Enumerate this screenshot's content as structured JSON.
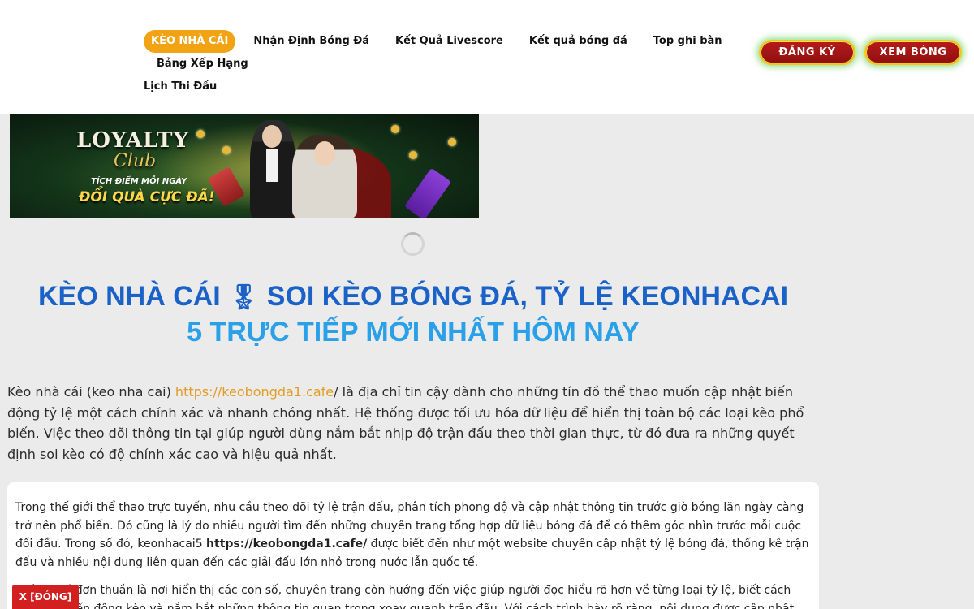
{
  "nav": {
    "items": [
      {
        "label": "KÈO NHÀ CÁI",
        "active": true
      },
      {
        "label": "Nhận Định Bóng Đá"
      },
      {
        "label": "Kết Quả Livescore"
      },
      {
        "label": "Kết quả bóng đá"
      },
      {
        "label": "Top ghi bàn"
      },
      {
        "label": "Bảng Xếp Hạng"
      },
      {
        "label": "Lịch Thi Đấu"
      }
    ],
    "active_color": "#f2a313"
  },
  "cta": {
    "register_label": "ĐĂNG KÝ",
    "watch_label": "XEM BÓNG",
    "color": "#b71c1c"
  },
  "banner": {
    "logo_line1": "LOYALTY",
    "logo_line2": "Club",
    "tagline1": "TÍCH ĐIỂM MỖI NGÀY",
    "tagline2": "ĐỔI QUÀ CỰC ĐÃ!"
  },
  "title": {
    "line1_part1": "KÈO NHÀ CÁI",
    "medal": "🎖",
    "line1_part2": "SOI KÈO BÓNG ĐÁ, TỶ LỆ KEONHACAI",
    "line2": "5 TRỰC TIẾP MỚI NHẤT HÔM NAY",
    "color1": "#1a62c8",
    "color2": "#2aa0e8"
  },
  "intro": {
    "before_link": "Kèo nhà cái (keo nha cai) ",
    "link": "https://keobongda1.cafe",
    "after_link": "/ là địa chỉ tin cậy dành cho những tín đồ thể thao muốn cập nhật biến động tỷ lệ một cách chính xác và nhanh chóng nhất. Hệ thống được tối ưu hóa dữ liệu để hiển thị toàn bộ các loại kèo phổ biến. Việc theo dõi thông tin tại giúp người dùng nắm bắt nhịp độ trận đấu theo thời gian thực, từ đó đưa ra những quyết định soi kèo có độ chính xác cao và hiệu quả nhất."
  },
  "content": {
    "p1_before": "Trong thế giới thể thao trực tuyến, nhu cầu theo dõi tỷ lệ trận đấu, phân tích phong độ và cập nhật thông tin trước giờ bóng lăn ngày càng trở nên phổ biến. Đó cũng là lý do nhiều người tìm đến những chuyên trang tổng hợp dữ liệu bóng đá để có thêm góc nhìn trước mỗi cuộc đối đầu. Trong số đó, keonhacai5 ",
    "p1_strong": "https://keobongda1.cafe/",
    "p1_after": " được biết đến như một website chuyên cập nhật tỷ lệ bóng đá, thống kê trận đấu và nhiều nội dung liên quan đến các giải đấu lớn nhỏ trong nước lẫn quốc tế.",
    "p2": "Không chỉ đơn thuần là nơi hiển thị các con số, chuyên trang còn hướng đến việc giúp người đọc hiểu rõ hơn về từng loại tỷ lệ, biết cách theo dõi biến động kèo và nắm bắt những thông tin quan trọng xoay quanh trận đấu. Với cách trình bày rõ ràng, nội dung được cập nhật liên tục"
  },
  "close_label": "X [ĐÓNG]"
}
